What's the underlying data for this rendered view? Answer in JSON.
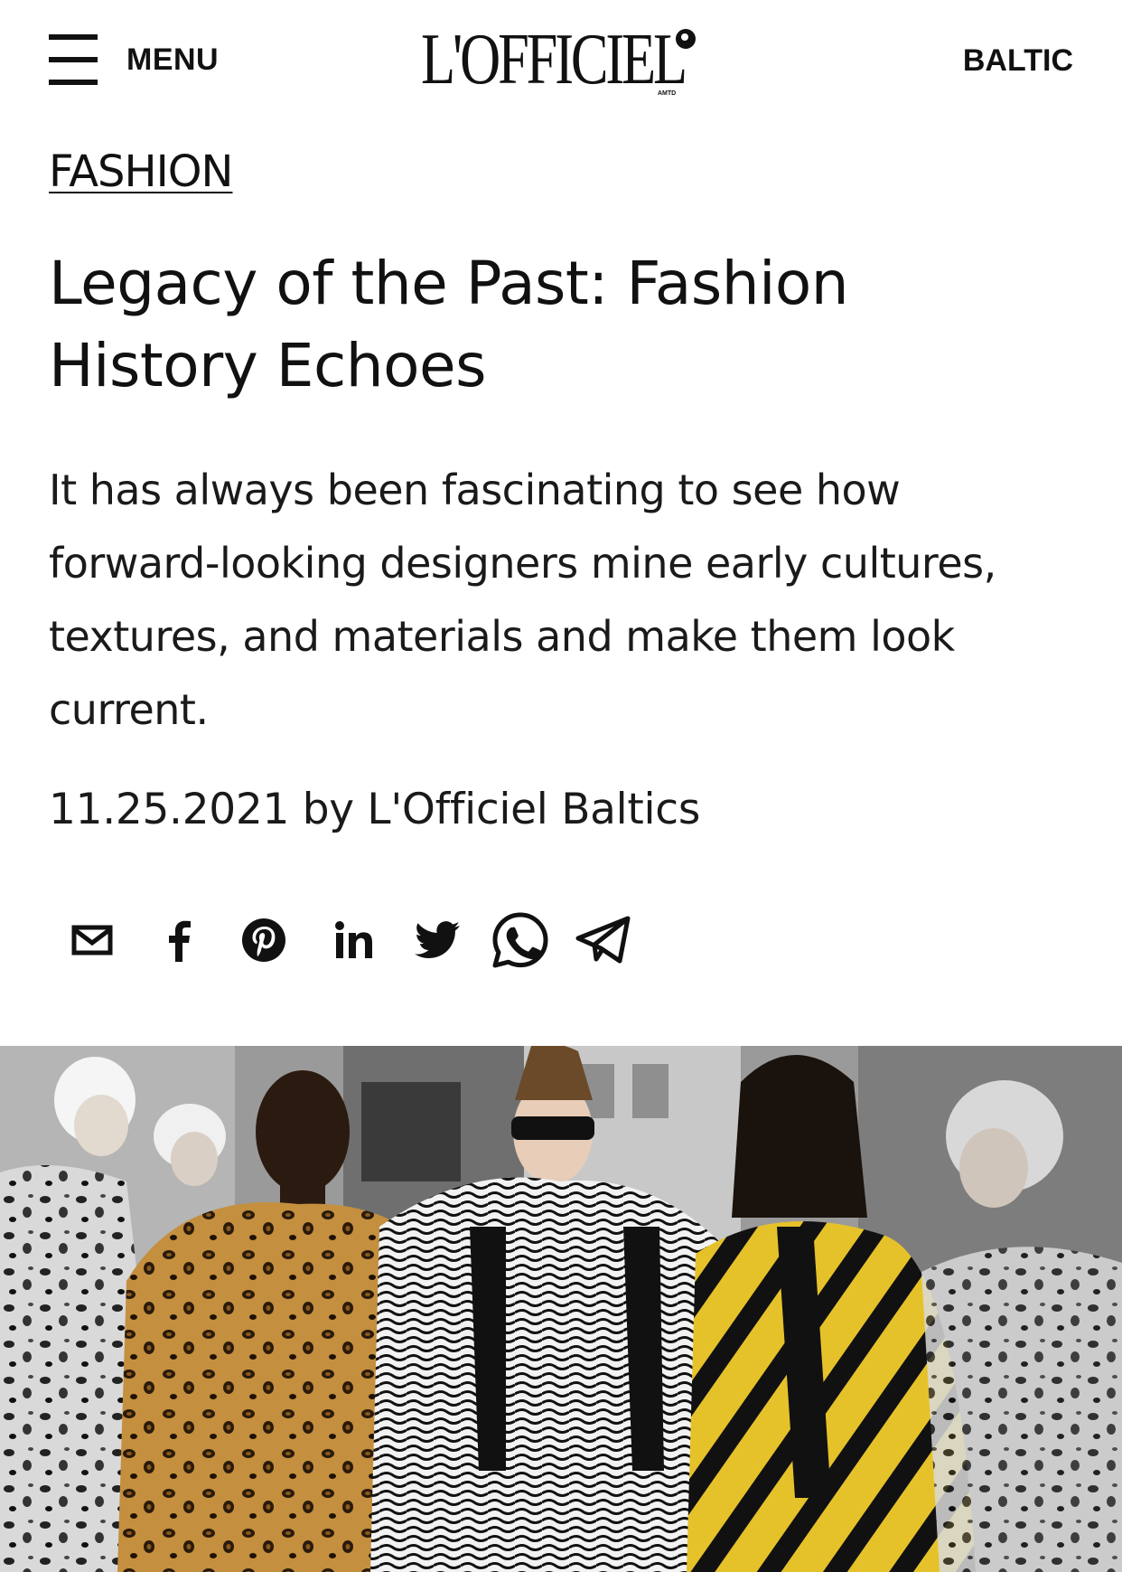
{
  "header": {
    "menu_label": "MENU",
    "logo_text": "L'OFFICIEL",
    "logo_sub": "AMTD",
    "region_label": "BALTIC"
  },
  "article": {
    "category": "FASHION",
    "title": "Legacy of the Past: Fashion History Echoes",
    "dek": "It has always been fascinating to see how forward-looking designers mine early cultures, textures, and materials and make them look current.",
    "byline": "11.25.2021 by L'Officiel Baltics"
  },
  "share": {
    "icons": [
      "email-icon",
      "facebook-icon",
      "pinterest-icon",
      "linkedin-icon",
      "twitter-icon",
      "whatsapp-icon",
      "telegram-icon"
    ]
  },
  "hero_image": {
    "subject": "collage of runway models in animal prints beside vintage black-and-white photos"
  },
  "colors": {
    "text": "#111111",
    "background": "#ffffff",
    "leopard": "#b07a2e",
    "yellow_stripe": "#e6c22a"
  }
}
